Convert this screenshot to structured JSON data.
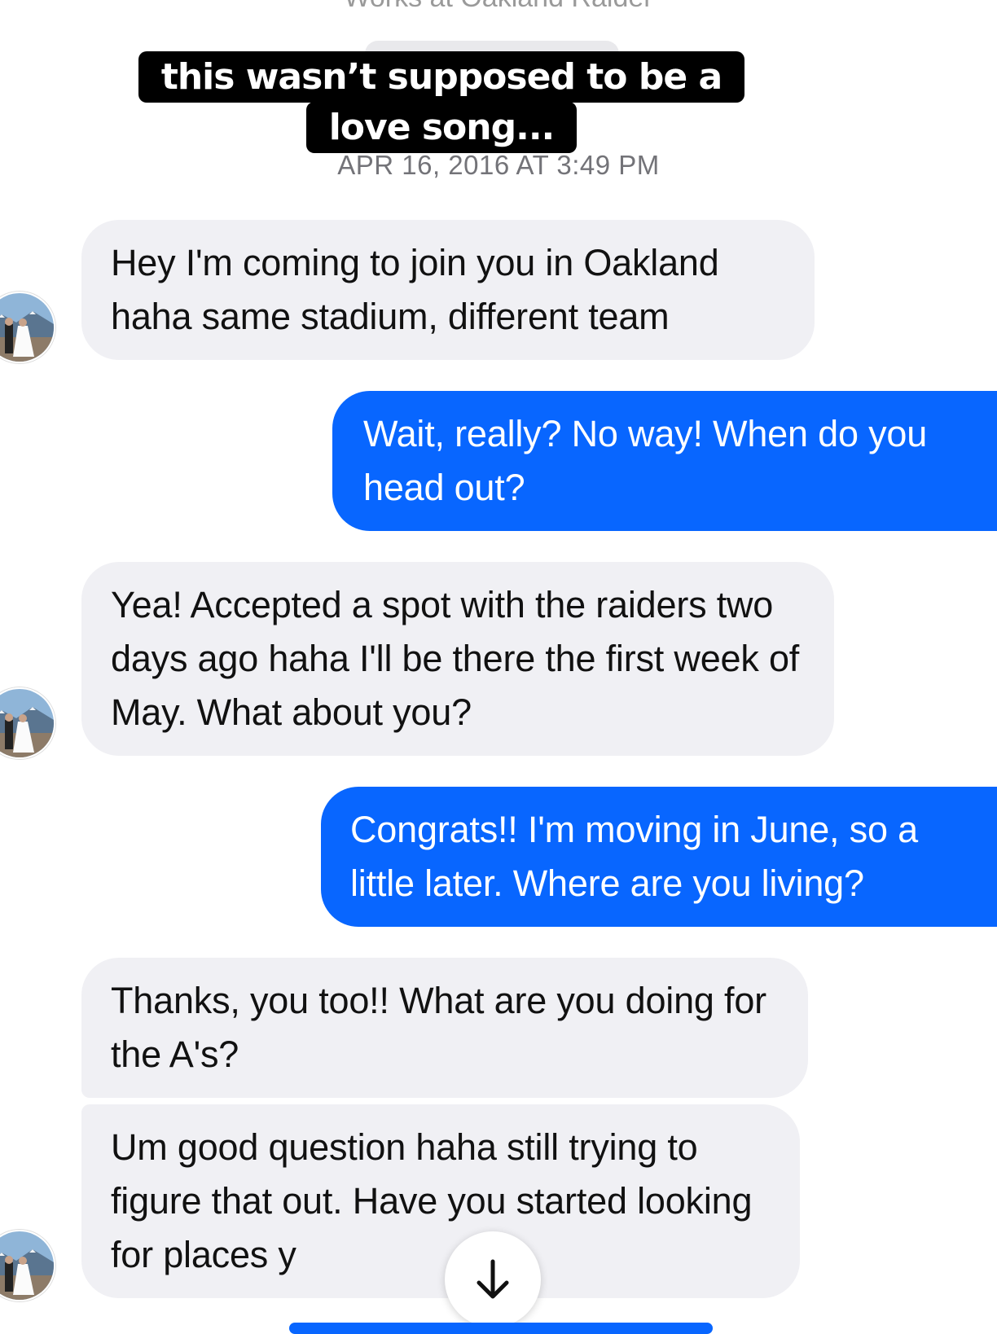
{
  "header": {
    "subtitle_fragment": "Works at Oakland Raider",
    "timestamp": "APR 16, 2016 AT 3:49 PM"
  },
  "caption": "this wasn’t supposed to be a love song...",
  "messages": [
    {
      "direction": "incoming",
      "text": "Hey I'm coming to join you in Oakland haha same stadium, different team"
    },
    {
      "direction": "outgoing",
      "text": "Wait, really? No way! When do you head out?"
    },
    {
      "direction": "incoming",
      "text": "Yea! Accepted a spot with the raiders two days ago haha I'll be there the first week of May. What about you?"
    },
    {
      "direction": "outgoing",
      "text": "Congrats!! I'm moving in June, so a little later. Where are you living?"
    },
    {
      "direction": "incoming",
      "text": "Thanks, you too!! What are you doing for the A's?"
    },
    {
      "direction": "incoming",
      "text": "Um good question haha still trying to figure that out. Have you started looking for places y"
    }
  ],
  "icons": {
    "avatar": "contact-avatar-photo",
    "scroll": "arrow-down-icon"
  },
  "colors": {
    "outgoing_bubble": "#0866ff",
    "incoming_bubble": "#f0f0f4",
    "caption_background": "#000000",
    "timestamp_text": "#737378"
  }
}
